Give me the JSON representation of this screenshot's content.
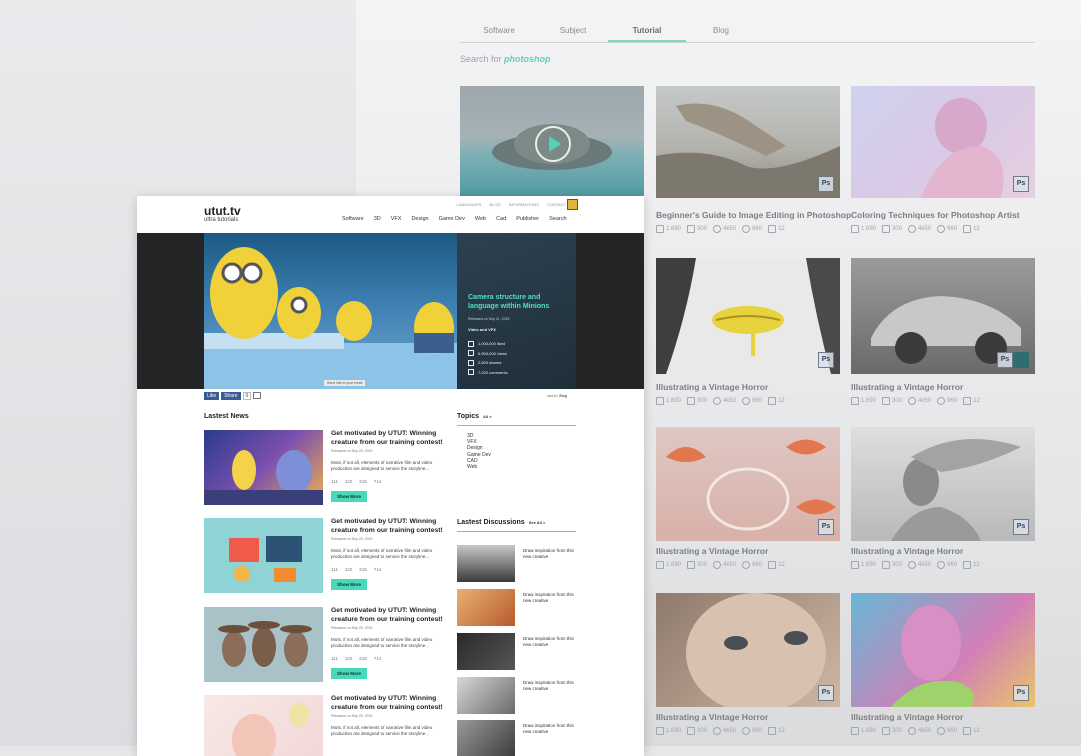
{
  "back_page": {
    "tabs": [
      {
        "label": "Software",
        "active": false
      },
      {
        "label": "Subject",
        "active": false
      },
      {
        "label": "Tutorial",
        "active": true
      },
      {
        "label": "Blog",
        "active": false
      }
    ],
    "search_prefix": "Search for",
    "search_term": "photoshop",
    "cards": [
      {
        "title": "",
        "badge": "",
        "stats": [
          "",
          "",
          "",
          "",
          ""
        ]
      },
      {
        "title": "Beginner's Guide to Image Editing in Photoshop",
        "badge": "Ps",
        "stats": [
          "1.690",
          "300",
          "4k50",
          "960",
          "12"
        ]
      },
      {
        "title": "Coloring Techniques for Photoshop Artist",
        "badge": "Ps",
        "stats": [
          "1.690",
          "300",
          "4k50",
          "960",
          "12"
        ]
      },
      {
        "title": "Illustrating a Vintage Horror",
        "badge": "Ps",
        "stats": [
          "1.690",
          "300",
          "4k50",
          "960",
          "12"
        ]
      },
      {
        "title": "Illustrating a Vintage Horror",
        "badge": "Ps",
        "stats": [
          "1.690",
          "300",
          "4k50",
          "960",
          "12"
        ]
      },
      {
        "title": "Illustrating a Vintage Horror",
        "badge": "Ps",
        "stats": [
          "1.690",
          "300",
          "4k50",
          "960",
          "12"
        ]
      },
      {
        "title": "Illustrating a Vintage Horror",
        "badge": "Ps",
        "stats": [
          "1.690",
          "300",
          "4k50",
          "960",
          "12"
        ]
      },
      {
        "title": "Illustrating a Vintage Horror",
        "badge": "Ps",
        "stats": [
          "1.690",
          "300",
          "4k50",
          "960",
          "12"
        ]
      },
      {
        "title": "Illustrating a Vintage Horror",
        "badge": "Ps",
        "stats": [
          "1.690",
          "300",
          "4k50",
          "960",
          "12"
        ]
      }
    ]
  },
  "front_page": {
    "util_links": [
      "LANGUAGES",
      "BLOG",
      "INFORMATIONS",
      "CONTACT"
    ],
    "logo_title": "utut.tv",
    "logo_subtitle": "ultra tutorials",
    "nav": [
      "Software",
      "3D",
      "VFX",
      "Design",
      "Game Dev",
      "Web",
      "Cad",
      "Publisher",
      "Search"
    ],
    "hero": {
      "title": "Camera structure and language within Minions",
      "date": "Released on Sep 21, 2015",
      "category": "Video and VFX",
      "stats": [
        "1,000,000 liked",
        "6,900,000 views",
        "2,600 shared",
        "7,020 comments"
      ],
      "send_link": "Send link to your email",
      "credit_site": "utut.tv",
      "credit_blog": "Blog"
    },
    "share": {
      "like": "Like",
      "share": "Share",
      "count": "0"
    },
    "latest_news_title": "Lastest News",
    "news": [
      {
        "title": "Get motivated by UTUT: Winning creature from our training contest!",
        "date": "Released on Sep 20, 2015",
        "text": "Most, if not all, elements of narrative film and video production are designed to service the storyline...",
        "stats": [
          "111",
          "122",
          "615",
          "714"
        ],
        "button": "Show More"
      },
      {
        "title": "Get motivated by UTUT: Winning creature from our training contest!",
        "date": "Released on Sep 20, 2015",
        "text": "Most, if not all, elements of narrative film and video production are designed to service the storyline...",
        "stats": [
          "111",
          "122",
          "615",
          "714"
        ],
        "button": "Show More"
      },
      {
        "title": "Get motivated by UTUT: Winning creature from our training contest!",
        "date": "Released on Sep 20, 2015",
        "text": "Most, if not all, elements of narrative film and video production are designed to service the storyline...",
        "stats": [
          "111",
          "122",
          "615",
          "714"
        ],
        "button": "Show More"
      },
      {
        "title": "Get motivated by UTUT: Winning creature from our training contest!",
        "date": "Released on Sep 20, 2015",
        "text": "Most, if not all, elements of narrative film and video production are designed to service the storyline...",
        "stats": [
          "",
          "",
          "",
          ""
        ],
        "button": ""
      }
    ],
    "topics_title": "Topics",
    "topics_all": "All >",
    "topics": [
      "3D",
      "VFX",
      "Design",
      "Game Dev",
      "CAD",
      "Web"
    ],
    "discussions_title": "Lastest Discussions",
    "discussions_all": "See All >",
    "discussions": [
      {
        "text": "Draw inspiration from this new creative"
      },
      {
        "text": "Draw inspiration from this new creative"
      },
      {
        "text": "Draw inspiration from this new creative"
      },
      {
        "text": "Draw inspiration from this new creative"
      },
      {
        "text": "Draw inspiration from this new creative"
      }
    ]
  }
}
